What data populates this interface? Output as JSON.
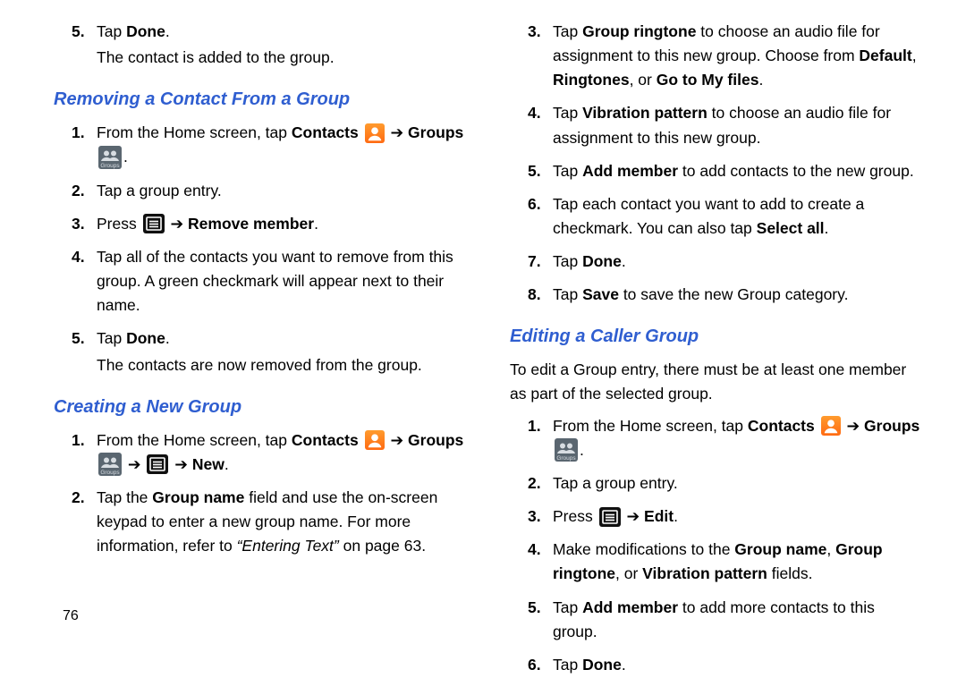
{
  "page_number": "76",
  "arrow": "➔",
  "left": {
    "pre_steps": {
      "s5_a": "Tap ",
      "s5_b": "Done",
      "s5_c": ".",
      "s5_sub": "The contact is added to the group."
    },
    "h1": "Removing a Contact From a Group",
    "removing": {
      "s1_a": "From the Home screen, tap ",
      "s1_b": "Contacts",
      "s1_c": "Groups",
      "s1_d": ".",
      "s2": "Tap a group entry.",
      "s3_a": "Press ",
      "s3_b": "Remove member",
      "s3_c": ".",
      "s4": "Tap all of the contacts you want to remove from this group. A green checkmark will appear next to their name.",
      "s5_a": "Tap ",
      "s5_b": "Done",
      "s5_c": ".",
      "s5_sub": "The contacts are now removed from the group."
    },
    "h2": "Creating a New Group",
    "creating": {
      "s1_a": "From the Home screen, tap ",
      "s1_b": "Contacts",
      "s1_c": "Groups",
      "s1_d": "New",
      "s1_e": ".",
      "s2_a": "Tap the ",
      "s2_b": "Group name",
      "s2_c": " field and use the on-screen keypad to enter a new group name. For more information, refer to ",
      "s2_d": "“Entering Text”",
      "s2_e": " on page 63."
    }
  },
  "right": {
    "creating_cont": {
      "s3_a": "Tap ",
      "s3_b": "Group ringtone",
      "s3_c": " to choose an audio file for assignment to this new group. Choose from ",
      "s3_d": "Default",
      "s3_e": ", ",
      "s3_f": "Ringtones",
      "s3_g": ", or ",
      "s3_h": "Go to My files",
      "s3_i": ".",
      "s4_a": "Tap ",
      "s4_b": "Vibration pattern",
      "s4_c": " to choose an audio file for assignment to this new group.",
      "s5_a": "Tap ",
      "s5_b": "Add member",
      "s5_c": " to add contacts to the new group.",
      "s6_a": "Tap each contact you want to add to create a checkmark. You can also tap ",
      "s6_b": "Select all",
      "s6_c": ".",
      "s7_a": "Tap ",
      "s7_b": "Done",
      "s7_c": ".",
      "s8_a": "Tap ",
      "s8_b": "Save",
      "s8_c": " to save the new Group category."
    },
    "h3": "Editing a Caller Group",
    "edit_intro": "To edit a Group entry, there must be at least one member as part of the selected group.",
    "editing": {
      "s1_a": "From the Home screen, tap ",
      "s1_b": "Contacts",
      "s1_c": "Groups",
      "s1_d": ".",
      "s2": "Tap a group entry.",
      "s3_a": "Press ",
      "s3_b": "Edit",
      "s3_c": ".",
      "s4_a": "Make modifications to the ",
      "s4_b": "Group name",
      "s4_c": ", ",
      "s4_d": "Group ringtone",
      "s4_e": ", or ",
      "s4_f": "Vibration pattern",
      "s4_g": " fields.",
      "s5_a": "Tap ",
      "s5_b": "Add member",
      "s5_c": " to add more contacts to this group.",
      "s6_a": "Tap ",
      "s6_b": "Done",
      "s6_c": "."
    }
  }
}
